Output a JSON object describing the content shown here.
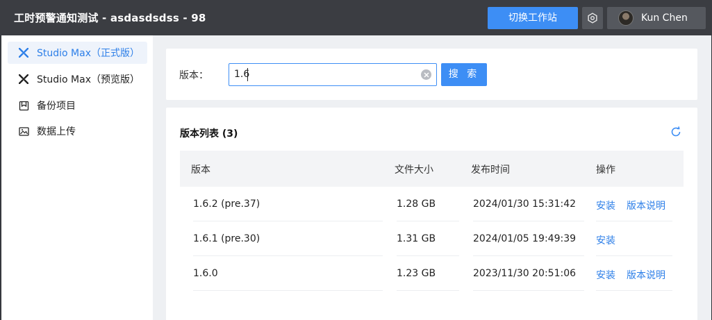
{
  "header": {
    "title": "工时预警通知测试 - asdasdsdss - 98",
    "switch_label": "切换工作站",
    "user_name": "Kun Chen"
  },
  "sidebar": {
    "items": [
      {
        "label": "Studio Max（正式版）",
        "icon": "studio-max-icon",
        "active": true
      },
      {
        "label": "Studio Max（预览版）",
        "icon": "studio-max-icon",
        "active": false
      },
      {
        "label": "备份项目",
        "icon": "backup-icon",
        "active": false
      },
      {
        "label": "数据上传",
        "icon": "upload-icon",
        "active": false
      }
    ]
  },
  "search": {
    "label": "版本：",
    "value": "1.6",
    "button_label": "搜 索"
  },
  "list": {
    "title": "版本列表 (3)",
    "columns": [
      "版本",
      "文件大小",
      "发布时间",
      "操作"
    ],
    "rows": [
      {
        "version": "1.6.2 (pre.37)",
        "size": "1.28 GB",
        "date": "2024/01/30 15:31:42",
        "install": "安装",
        "notes": "版本说明"
      },
      {
        "version": "1.6.1 (pre.30)",
        "size": "1.31 GB",
        "date": "2024/01/05 19:49:39",
        "install": "安装",
        "notes": ""
      },
      {
        "version": "1.6.0",
        "size": "1.23 GB",
        "date": "2023/11/30 20:51:06",
        "install": "安装",
        "notes": "版本说明"
      }
    ]
  },
  "colors": {
    "accent": "#3d8ef5",
    "header_bg": "#3b3d42",
    "link": "#2d7fe8"
  }
}
